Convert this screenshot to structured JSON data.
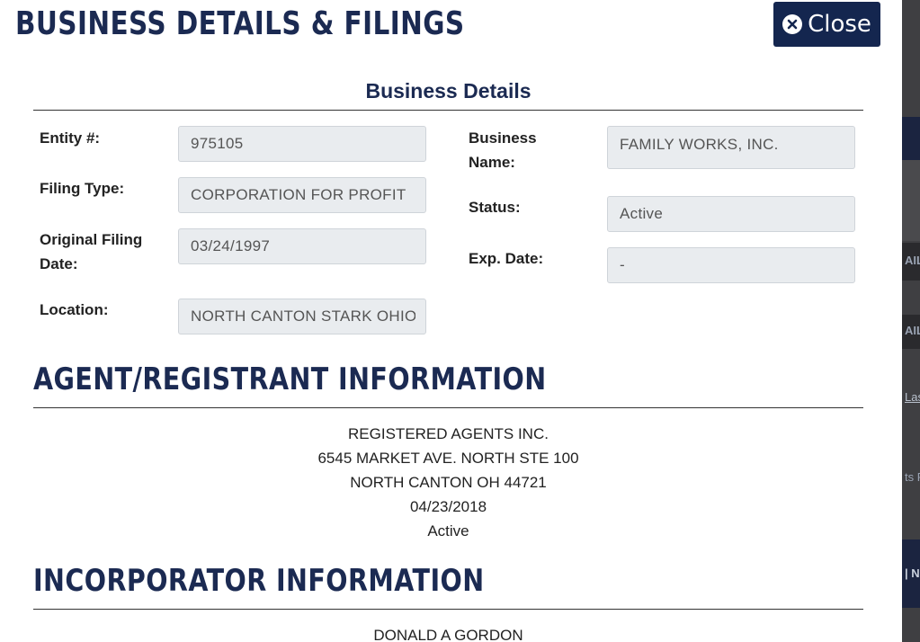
{
  "modal": {
    "title": "BUSINESS DETAILS & FILINGS",
    "close_label": "Close"
  },
  "business_details": {
    "heading": "Business Details",
    "entity_label": "Entity #:",
    "entity_value": "975105",
    "filing_type_label": "Filing Type:",
    "filing_type_value": "CORPORATION FOR PROFIT",
    "original_filing_date_label_line1": "Original Filing",
    "original_filing_date_label_line2": "Date:",
    "original_filing_date_value": "03/24/1997",
    "location_label": "Location:",
    "location_value": "NORTH CANTON STARK OHIO",
    "business_name_label_line1": "Business",
    "business_name_label_line2": "Name:",
    "business_name_value": "FAMILY WORKS, INC.",
    "status_label": "Status:",
    "status_value": "Active",
    "exp_date_label": "Exp. Date:",
    "exp_date_value": "-"
  },
  "agent": {
    "heading": "AGENT/REGISTRANT INFORMATION",
    "name": "REGISTERED AGENTS INC.",
    "address1": "6545 MARKET AVE. NORTH STE 100",
    "address2": "NORTH CANTON OH 44721",
    "date": "04/23/2018",
    "status": "Active"
  },
  "incorporator": {
    "heading": "INCORPORATOR INFORMATION",
    "name": "DONALD A GORDON"
  },
  "background": {
    "fragment1": "AILS",
    "fragment2": "AILS",
    "fragment3": "Las",
    "fragment4": "ts P",
    "fragment5": "| N"
  },
  "colors": {
    "navy": "#1b2a52",
    "button": "#14264f",
    "field_bg": "#e9ecef"
  }
}
